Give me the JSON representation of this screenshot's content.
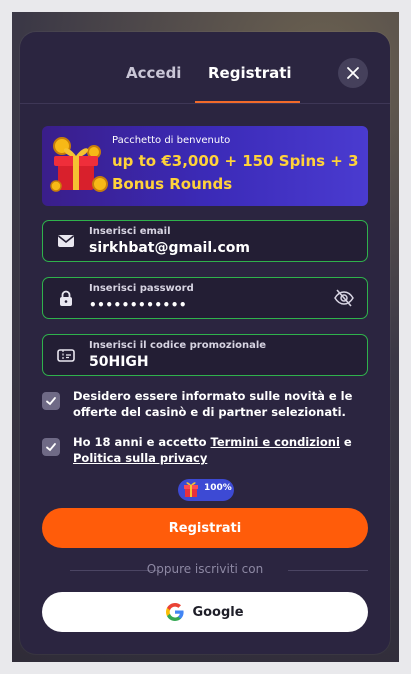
{
  "tabs": {
    "login": "Accedi",
    "register": "Registrati"
  },
  "banner": {
    "subtitle": "Pacchetto di benvenuto",
    "headline": "up to €3,000 + 150 Spins + 3 Bonus Rounds"
  },
  "fields": {
    "email": {
      "label": "Inserisci email",
      "value": "sirkhbat@gmail.com"
    },
    "password": {
      "label": "Inserisci password",
      "value": "••••••••••••"
    },
    "promo": {
      "label": "Inserisci il codice promozionale",
      "value": "50HIGH"
    }
  },
  "consent": {
    "marketing": {
      "text": "Desidero essere informato sulle novità e le offerte del casinò e di partner selezionati.",
      "checked": true
    },
    "terms": {
      "prefix": "Ho 18 anni e accetto ",
      "terms_link": "Termini e condizioni",
      "middle": " e ",
      "privacy_link": "Politica sulla privacy",
      "checked": true
    }
  },
  "badge": {
    "percent": "100%",
    "icon": "gift-icon"
  },
  "actions": {
    "register": "Registrati",
    "or_text": "Oppure iscriviti con",
    "google": "Google"
  },
  "colors": {
    "accent": "#ff5c0a",
    "success_border": "#2fb24c",
    "banner_text": "#ffd23a",
    "modal_bg": "#2b2540"
  }
}
